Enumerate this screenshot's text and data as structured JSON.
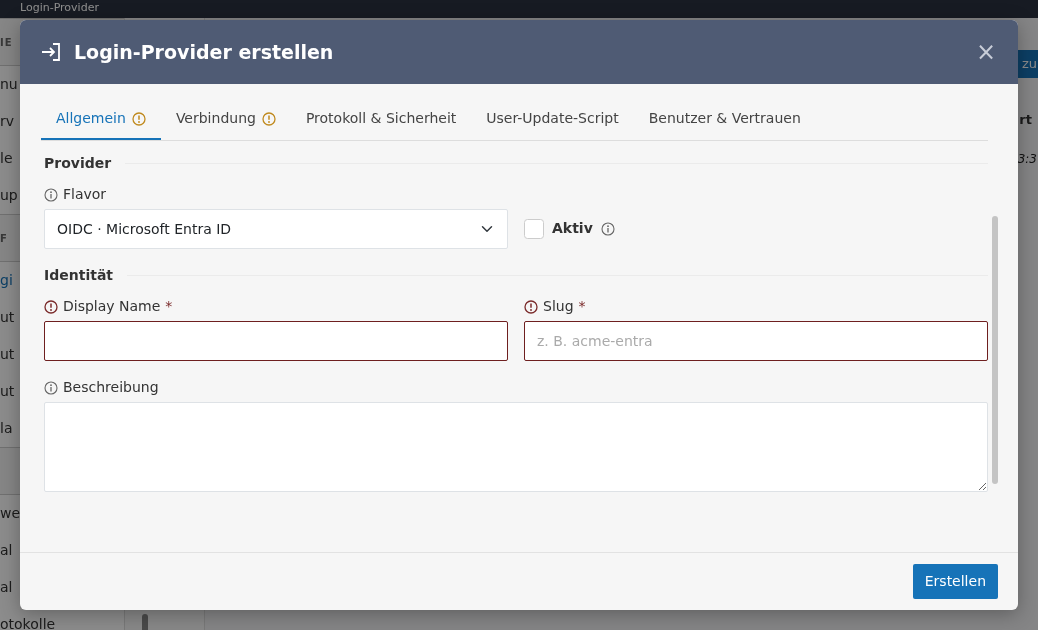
{
  "background": {
    "topbar_title": "Login-Provider",
    "sidebar": [
      {
        "kind": "section",
        "label": "IE"
      },
      {
        "kind": "item",
        "label": "nu",
        "selected": false
      },
      {
        "kind": "item",
        "label": "rv",
        "selected": false
      },
      {
        "kind": "item",
        "label": "le",
        "selected": false
      },
      {
        "kind": "item",
        "label": "up",
        "selected": false
      },
      {
        "kind": "section",
        "label": "F"
      },
      {
        "kind": "item",
        "label": "gi",
        "selected": true
      },
      {
        "kind": "item",
        "label": "ut",
        "selected": false
      },
      {
        "kind": "item",
        "label": "ut",
        "selected": false
      },
      {
        "kind": "item",
        "label": "ut",
        "selected": false
      },
      {
        "kind": "item",
        "label": "la",
        "selected": false
      },
      {
        "kind": "divider"
      },
      {
        "kind": "item",
        "label": "we",
        "selected": false
      },
      {
        "kind": "item",
        "label": "al",
        "selected": false
      },
      {
        "kind": "item",
        "label": "al",
        "selected": false
      },
      {
        "kind": "item",
        "label": "otokolle",
        "selected": false
      }
    ],
    "add_button": "zu",
    "table_header": "rt",
    "table_cell": "3:3"
  },
  "modal": {
    "title": "Login-Provider erstellen",
    "close_label": "×",
    "tabs": [
      {
        "label": "Allgemein",
        "selected": true,
        "warning": true
      },
      {
        "label": "Verbindung",
        "selected": false,
        "warning": true
      },
      {
        "label": "Protokoll & Sicherheit",
        "selected": false,
        "warning": false
      },
      {
        "label": "User-Update-Script",
        "selected": false,
        "warning": false
      },
      {
        "label": "Benutzer & Vertrauen",
        "selected": false,
        "warning": false
      }
    ],
    "sections": [
      {
        "title": "Provider",
        "rows": [
          [
            {
              "kind": "select",
              "label": "Flavor",
              "value": "OIDC · Microsoft Entra ID",
              "invalid": false
            },
            {
              "kind": "checkbox",
              "label": "Aktiv",
              "checked": false
            }
          ]
        ]
      },
      {
        "title": "Identität",
        "rows": [
          [
            {
              "kind": "text",
              "label": "Display Name",
              "required_mark": "*",
              "invalid": true
            },
            {
              "kind": "text",
              "label": "Slug",
              "placeholder": "z. B. acme-entra",
              "required_mark": "*",
              "invalid": true
            }
          ],
          [
            {
              "kind": "textarea",
              "label": "Beschreibung",
              "invalid": false
            }
          ]
        ]
      }
    ],
    "submit": "Erstellen"
  }
}
